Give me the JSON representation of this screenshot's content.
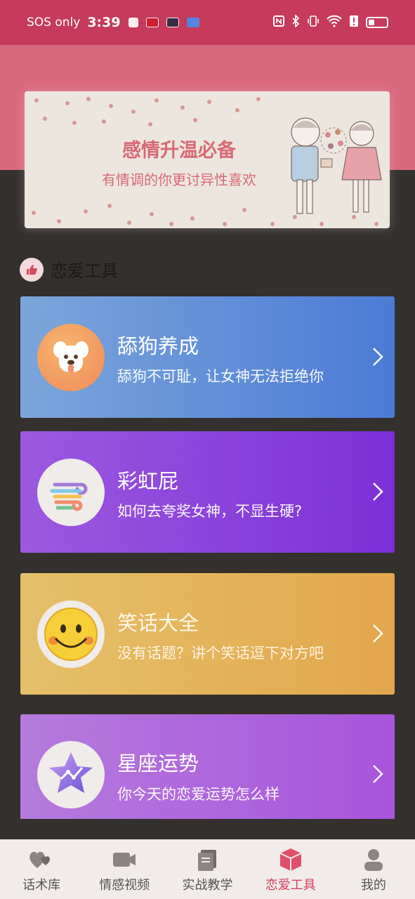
{
  "status_bar": {
    "carrier": "SOS only",
    "time": "3:39"
  },
  "banner": {
    "title": "感情升温必备",
    "subtitle": "有情调的你更讨异性喜欢"
  },
  "section": {
    "title": "恋爱工具"
  },
  "cards": [
    {
      "title": "舔狗养成",
      "subtitle": "舔狗不可耻，让女神无法拒绝你",
      "icon": "dog-icon"
    },
    {
      "title": "彩虹屁",
      "subtitle": "如何去夸奖女神，不显生硬?",
      "icon": "rainbow-icon"
    },
    {
      "title": "笑话大全",
      "subtitle": "没有话题？讲个笑话逗下对方吧",
      "icon": "smiley-icon"
    },
    {
      "title": "星座运势",
      "subtitle": "你今天的恋爱运势怎么样",
      "icon": "star-icon"
    }
  ],
  "bottom_nav": [
    {
      "label": "话术库",
      "icon": "hearts-icon"
    },
    {
      "label": "情感视频",
      "icon": "video-icon"
    },
    {
      "label": "实战教学",
      "icon": "book-icon"
    },
    {
      "label": "恋爱工具",
      "icon": "cube-icon",
      "active": true
    },
    {
      "label": "我的",
      "icon": "person-icon"
    }
  ],
  "colors": {
    "status_bar": "#c63a5c",
    "accent": "#d64160",
    "background": "#34302d"
  }
}
